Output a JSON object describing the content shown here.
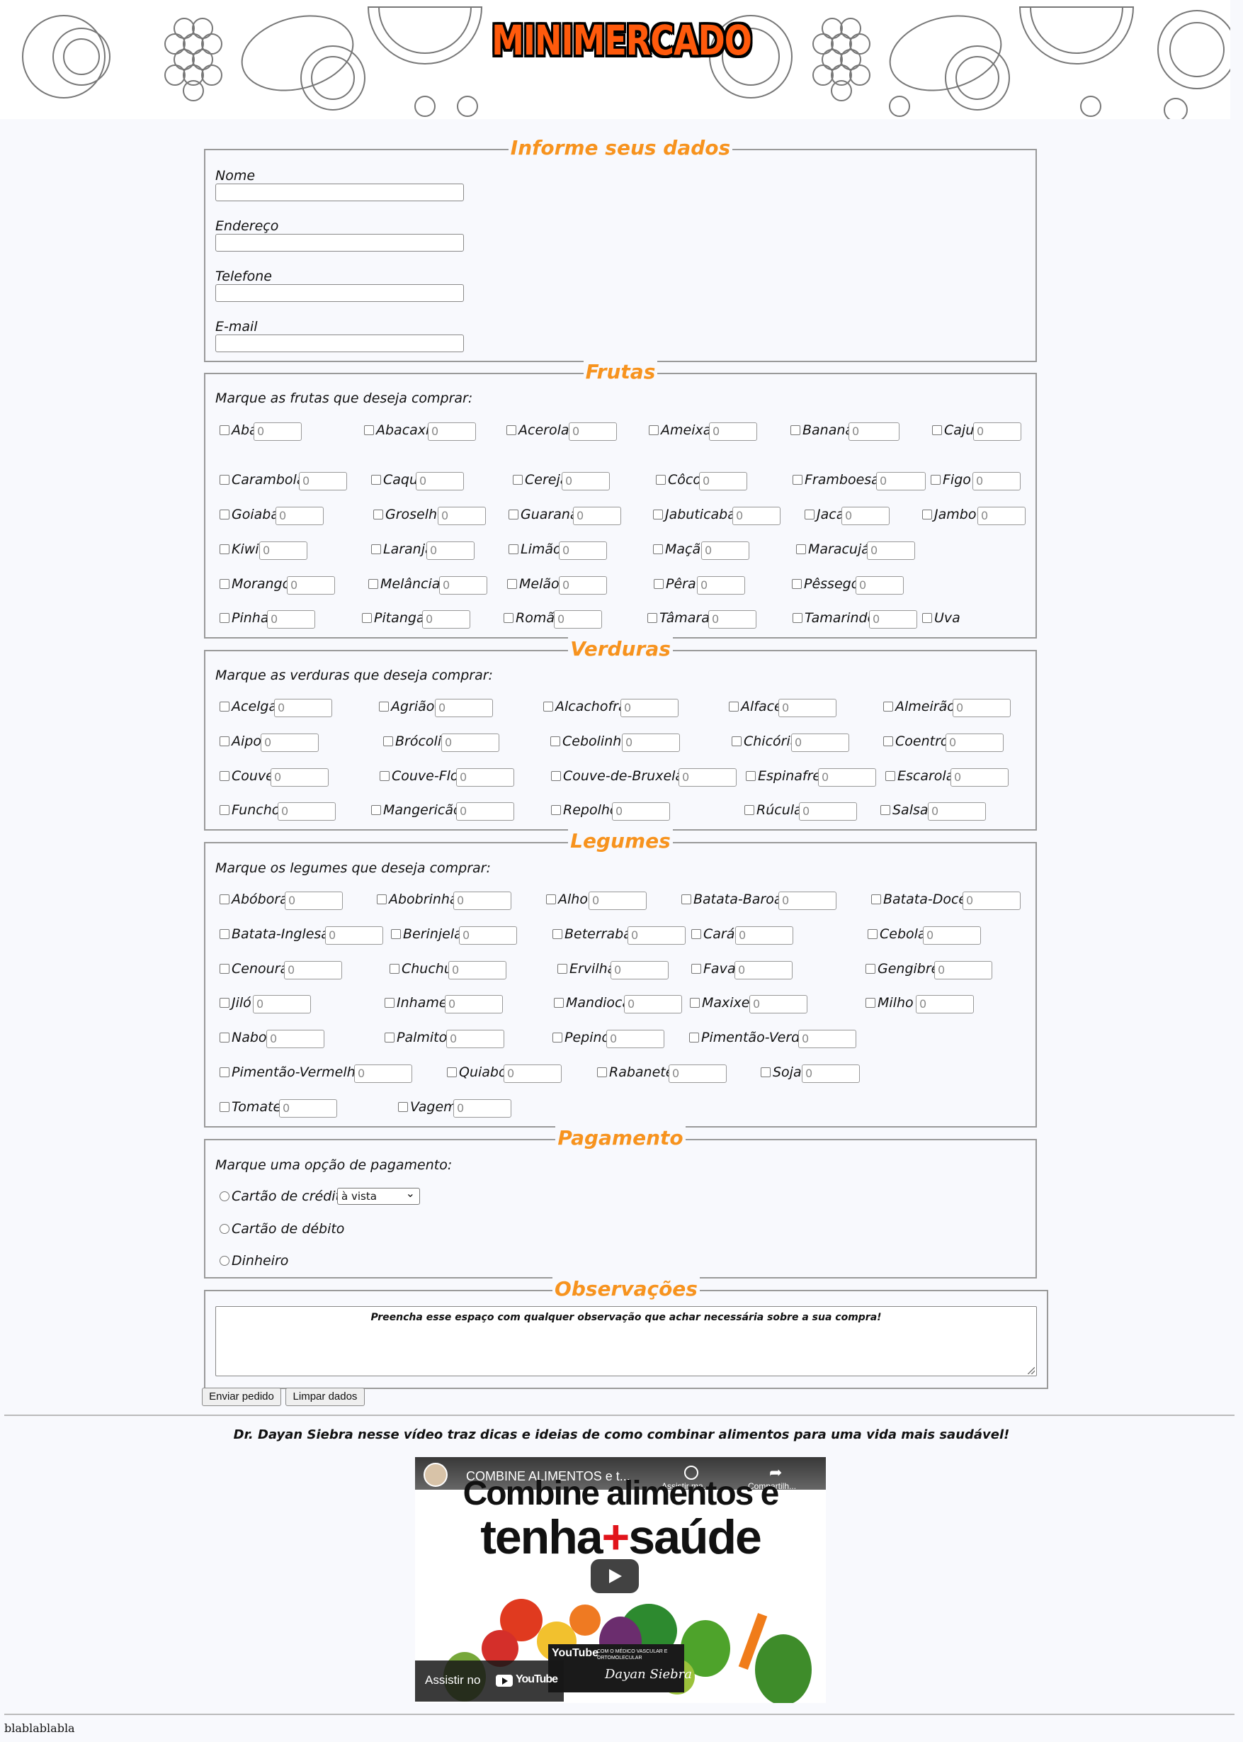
{
  "header": {
    "logo_text": "MINIMERCADO"
  },
  "dados": {
    "legend": "Informe seus dados",
    "fields": [
      {
        "label": "Nome",
        "value": ""
      },
      {
        "label": "Endereço",
        "value": ""
      },
      {
        "label": "Telefone",
        "value": ""
      },
      {
        "label": "E-mail",
        "value": ""
      }
    ]
  },
  "frutas": {
    "legend": "Frutas",
    "prompt": "Marque as frutas que deseja comprar:",
    "items": [
      "Abacate",
      "Abacaxi",
      "Acerola",
      "Ameixa",
      "Banana",
      "Caju",
      "Carambola",
      "Caquí",
      "Cereja",
      "Côco",
      "Framboesa",
      "Figo",
      "Goiaba",
      "Groselha",
      "Guaraná",
      "Jabuticaba",
      "Jaca",
      "Jambo",
      "Kiwi",
      "Laranja",
      "Limão",
      "Maçã",
      "Maracujá",
      "Morango",
      "Melância",
      "Melão",
      "Pêra",
      "Pêssego",
      "Pinha",
      "Pitanga",
      "Romã",
      "Tâmara",
      "Tamarindo",
      "Uva"
    ],
    "placeholder": "0"
  },
  "verduras": {
    "legend": "Verduras",
    "prompt": "Marque as verduras que deseja comprar:",
    "items": [
      "Acelga",
      "Agrião",
      "Alcachofra",
      "Alface",
      "Almeirão",
      "Aipo",
      "Brócolis",
      "Cebolinha",
      "Chicória",
      "Coentro",
      "Couve",
      "Couve-Flor",
      "Couve-de-Bruxelas",
      "Espinafre",
      "Escarola",
      "Funcho",
      "Mangericão",
      "Repolho",
      "Rúcula",
      "Salsa"
    ],
    "placeholder": "0"
  },
  "legumes": {
    "legend": "Legumes",
    "prompt": "Marque os legumes que deseja comprar:",
    "items": [
      "Abóbora",
      "Abobrinha",
      "Alho",
      "Batata-Baroa",
      "Batata-Doce",
      "Batata-Inglesa",
      "Berinjela",
      "Beterraba",
      "Cará",
      "Cebola",
      "Cenoura",
      "Chuchu",
      "Ervilha",
      "Fava",
      "Gengibre",
      "Jiló",
      "Inhame",
      "Mandioca",
      "Maxixe",
      "Milho",
      "Nabo",
      "Palmito",
      "Pepino",
      "Pimentão-Verde",
      "Pimentão-Vermelho",
      "Quiabo",
      "Rabanete",
      "Soja",
      "Tomate",
      "Vagem"
    ],
    "placeholder": "0"
  },
  "pagamento": {
    "legend": "Pagamento",
    "prompt": "Marque uma opção de pagamento:",
    "options": [
      "Cartão de crédito",
      "Cartão de débito",
      "Dinheiro"
    ],
    "installments_selected": "à vista"
  },
  "observacoes": {
    "legend": "Observações",
    "placeholder": "Preencha esse espaço com qualquer observação que achar necessária sobre a sua compra!"
  },
  "buttons": {
    "submit": "Enviar pedido",
    "reset": "Limpar dados"
  },
  "video": {
    "caption": "Dr. Dayan Siebra nesse vídeo traz dicas e ideias de como combinar alimentos para uma vida mais saudável!",
    "title": "COMBINE ALIMENTOS e t...",
    "watch_later": "Assistir ma...",
    "share": "Compartilh...",
    "thumb_line1": "Combine alimentos e",
    "thumb_line2a": "tenha",
    "thumb_line2b": "saúde",
    "watch_on": "Assistir no",
    "youtube": "YouTube",
    "channel_tag": "COM O MÉDICO VASCULAR E ORTOMOLECULAR",
    "signature": "Dayan Siebra"
  },
  "footer": {
    "text": "blablablabla"
  },
  "colors": {
    "accent": "#f7931e",
    "logo": "#ff5a0c",
    "background": "#f8f9fd",
    "border": "#9a9a9a"
  }
}
